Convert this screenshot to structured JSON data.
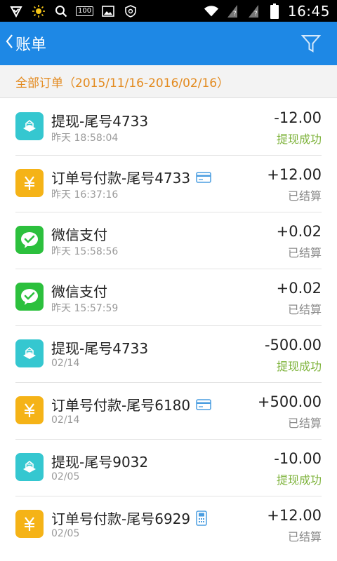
{
  "status_bar": {
    "time": "16:45",
    "battery_box": "100"
  },
  "header": {
    "back_label": "账单"
  },
  "range_label": "全部订单（2015/11/16-2016/02/16）",
  "colors": {
    "header_blue": "#1e88e5",
    "range_orange": "#e38a1e",
    "success_green": "#7eb33b"
  },
  "transactions": [
    {
      "type": "withdraw",
      "title": "提现-尾号4733",
      "date": "昨天 18:58:04",
      "amount": "-12.00",
      "status": "提现成功",
      "status_ok": true,
      "card": "none"
    },
    {
      "type": "order",
      "title": "订单号付款-尾号4733",
      "date": "昨天 16:37:16",
      "amount": "+12.00",
      "status": "已结算",
      "status_ok": false,
      "card": "bank-card"
    },
    {
      "type": "wechat",
      "title": "微信支付",
      "date": "昨天 15:58:56",
      "amount": "+0.02",
      "status": "已结算",
      "status_ok": false,
      "card": "none"
    },
    {
      "type": "wechat",
      "title": "微信支付",
      "date": "昨天 15:57:59",
      "amount": "+0.02",
      "status": "已结算",
      "status_ok": false,
      "card": "none"
    },
    {
      "type": "withdraw",
      "title": "提现-尾号4733",
      "date": "02/14",
      "amount": "-500.00",
      "status": "提现成功",
      "status_ok": true,
      "card": "none"
    },
    {
      "type": "order",
      "title": "订单号付款-尾号6180",
      "date": "02/14",
      "amount": "+500.00",
      "status": "已结算",
      "status_ok": false,
      "card": "bank-card"
    },
    {
      "type": "withdraw",
      "title": "提现-尾号9032",
      "date": "02/05",
      "amount": "-10.00",
      "status": "提现成功",
      "status_ok": true,
      "card": "none"
    },
    {
      "type": "order",
      "title": "订单号付款-尾号6929",
      "date": "02/05",
      "amount": "+12.00",
      "status": "已结算",
      "status_ok": false,
      "card": "pos-terminal"
    }
  ]
}
